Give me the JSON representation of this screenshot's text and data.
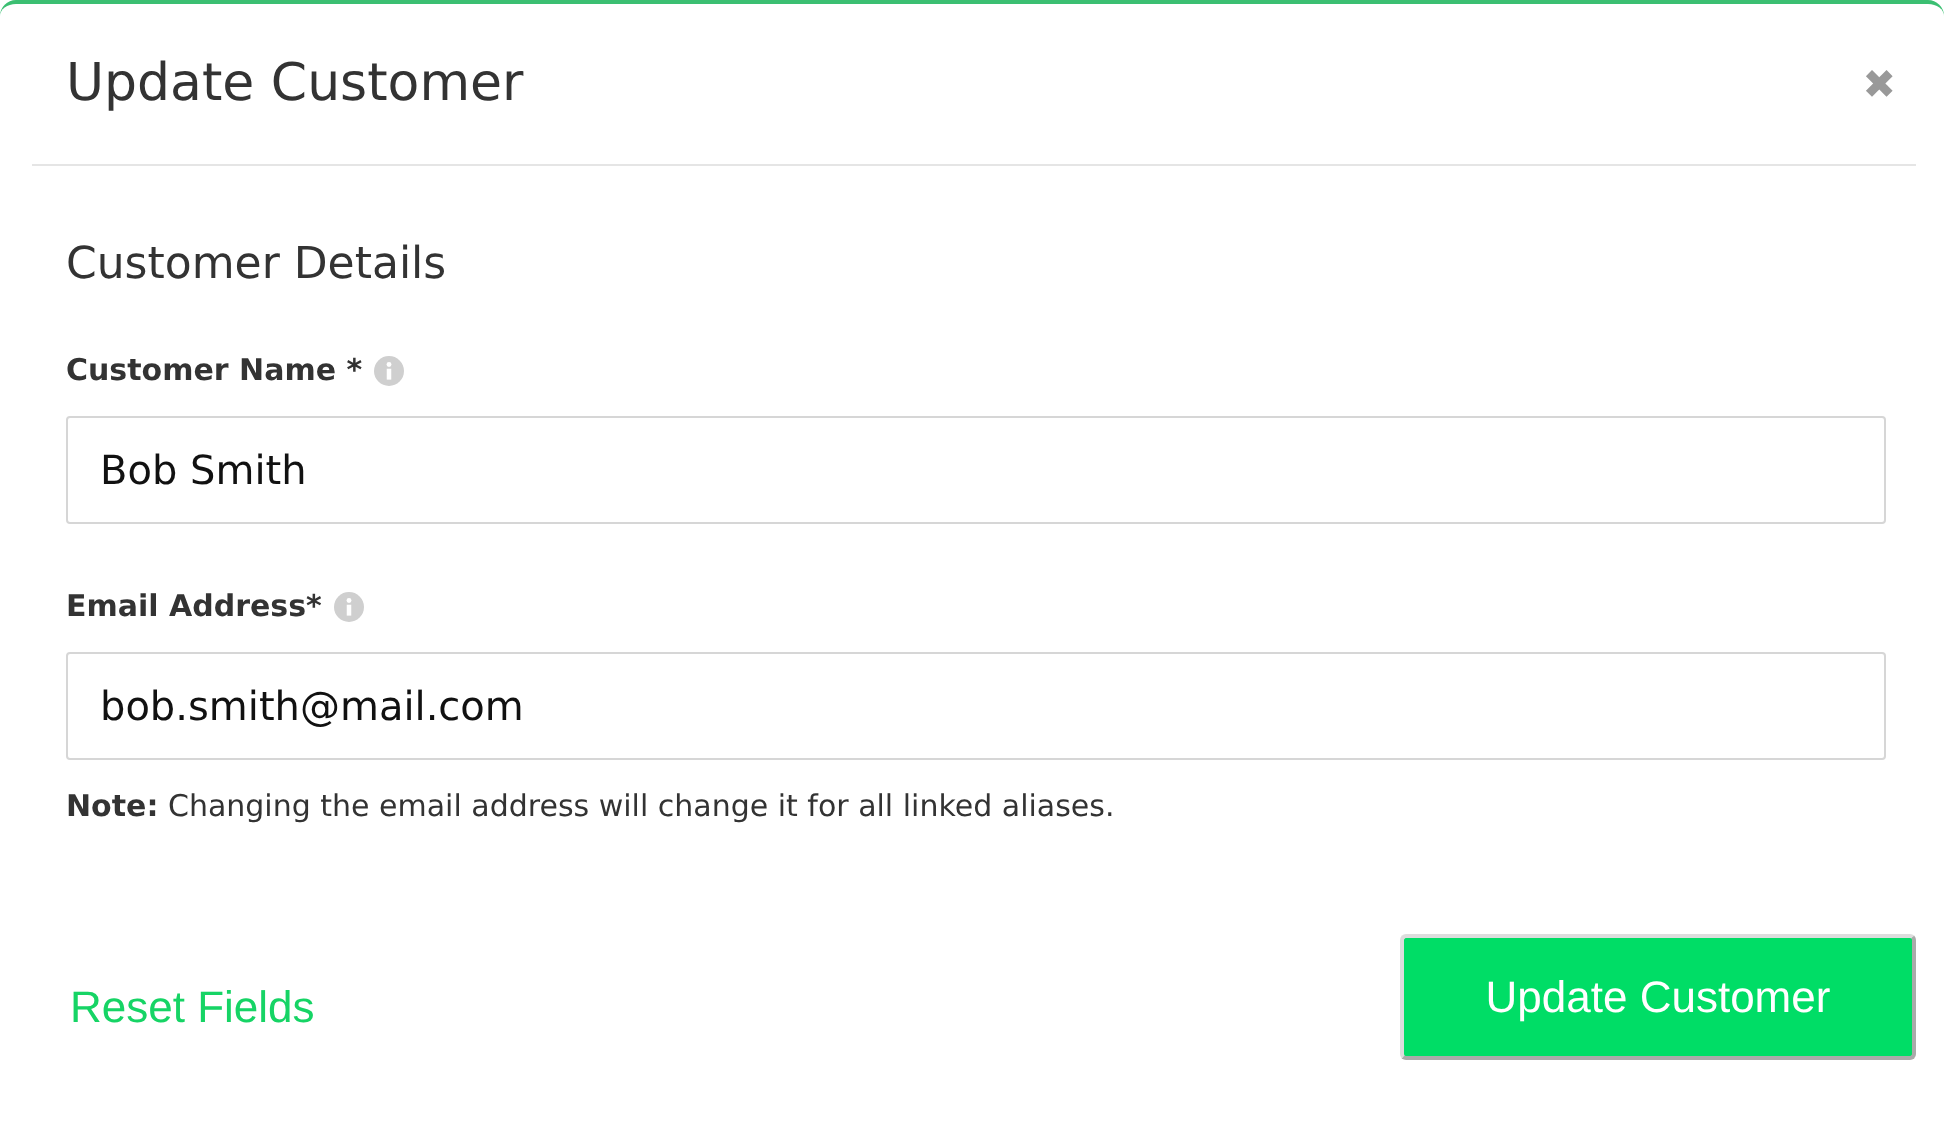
{
  "dialog": {
    "title": "Update Customer",
    "close": "✖"
  },
  "section": {
    "title": "Customer Details"
  },
  "fields": [
    {
      "label": "Customer Name *",
      "value": "Bob Smith"
    },
    {
      "label": "Email Address*",
      "value": "bob.smith@mail.com"
    }
  ],
  "note": "**Note:** Changing the email address will change it for all linked aliases.",
  "footer": {
    "reset_link": "Reset Fields",
    "submit_button": "Update Customer"
  }
}
